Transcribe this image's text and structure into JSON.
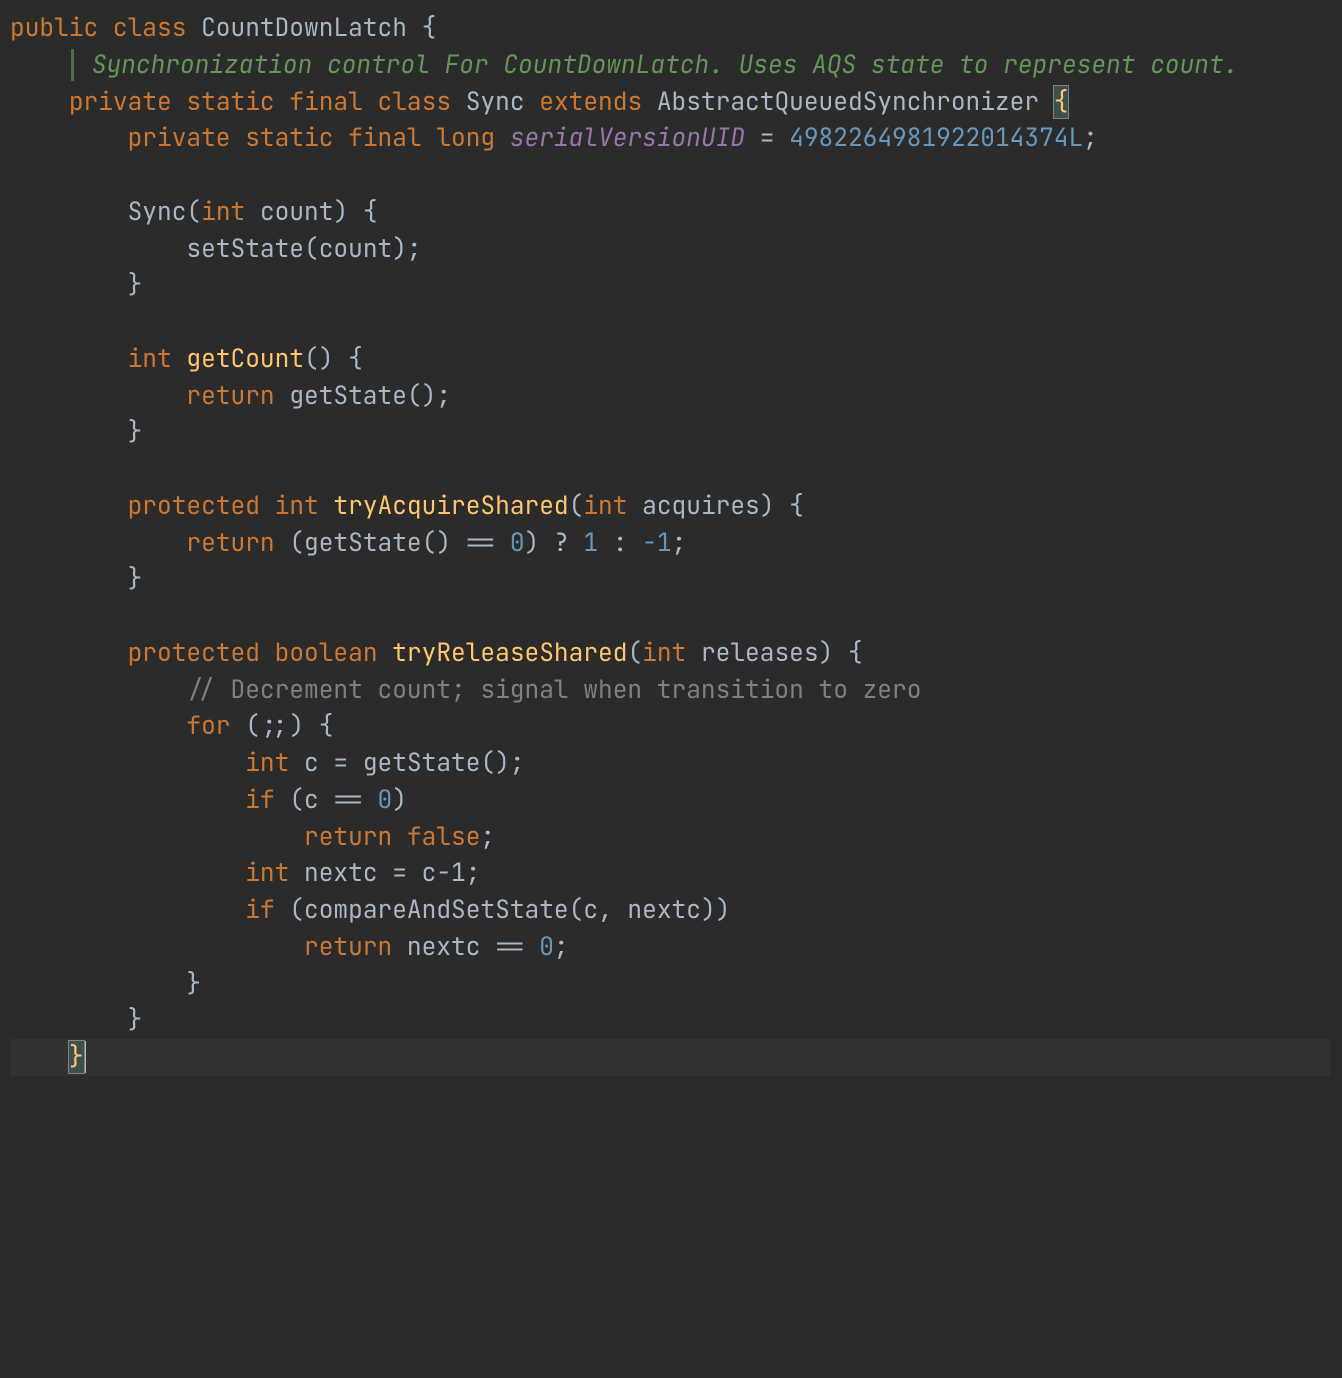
{
  "line1": {
    "kw_public": "public",
    "kw_class": "class",
    "name": "CountDownLatch",
    "brace": "{"
  },
  "doc": {
    "text": "Synchronization control For CountDownLatch. Uses AQS state to represent count."
  },
  "line3": {
    "kw_private": "private",
    "kw_static": "static",
    "kw_final": "final",
    "kw_class": "class",
    "name": "Sync",
    "kw_extends": "extends",
    "super": "AbstractQueuedSynchronizer",
    "brace": "{"
  },
  "line4": {
    "kw_private": "private",
    "kw_static": "static",
    "kw_final": "final",
    "kw_long": "long",
    "field": "serialVersionUID",
    "eq": "=",
    "value": "4982264981922014374L",
    "semi": ";"
  },
  "ctor": {
    "name": "Sync",
    "lp": "(",
    "kw_int": "int",
    "param": "count",
    "rp": ")",
    "brace": "{",
    "call": "setState",
    "arg": "count",
    "close": "}"
  },
  "getc": {
    "kw_int": "int",
    "name": "getCount",
    "lp": "()",
    "brace": "{",
    "kw_return": "return",
    "call": "getState",
    "close": "}"
  },
  "tryA": {
    "kw_protected": "protected",
    "kw_int": "int",
    "name": "tryAcquireShared",
    "lp": "(",
    "pint": "int",
    "param": "acquires",
    "rp": ")",
    "brace": "{",
    "kw_return": "return",
    "call": "getState",
    "eq": "==",
    "zero": "0",
    "q": "?",
    "one": "1",
    "colon": ":",
    "m1": "-1",
    "semi": ";",
    "close": "}"
  },
  "tryR": {
    "kw_protected": "protected",
    "kw_boolean": "boolean",
    "name": "tryReleaseShared",
    "lp": "(",
    "pint": "int",
    "param": "releases",
    "rp": ")",
    "brace": "{",
    "comment": "// Decrement count; signal when transition to zero",
    "kw_for": "for",
    "for_hdr": "(;;)",
    "for_brace": "{",
    "kw_int": "int",
    "var_c": "c",
    "eq": "=",
    "call_get": "getState",
    "kw_if": "if",
    "c": "c",
    "deq": "==",
    "zero": "0",
    "kw_ret_false": "return",
    "false": "false",
    "kw_int2": "int",
    "var_nextc": "nextc",
    "eq2": "=",
    "expr": "c-1",
    "kw_if2": "if",
    "call_cas": "compareAndSetState",
    "args": "c, nextc",
    "kw_ret2": "return",
    "nextc": "nextc",
    "deq2": "==",
    "zero2": "0",
    "close_for": "}",
    "close_fn": "}"
  },
  "close_sync": "}",
  "close_class": ""
}
